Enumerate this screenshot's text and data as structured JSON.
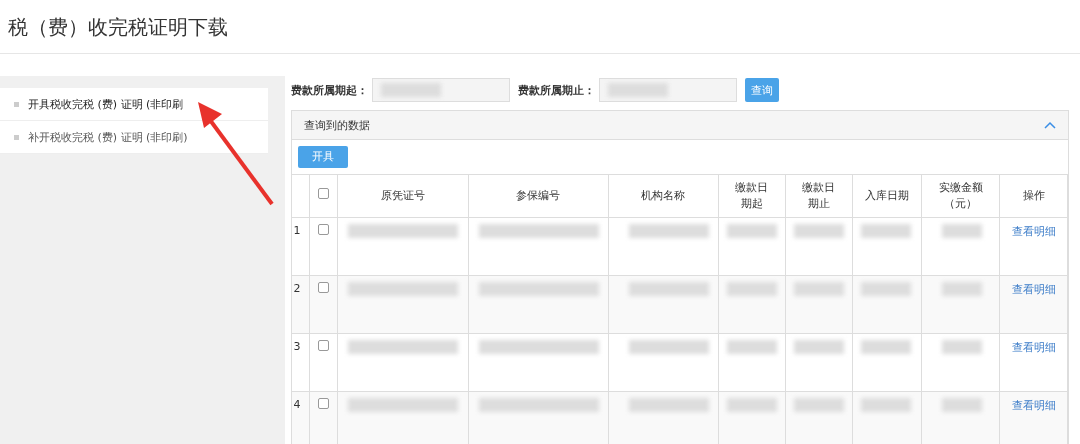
{
  "page_title": "税（费）收完税证明下载",
  "sidebar": {
    "items": [
      {
        "label": "开具税收完税 (费) 证明 (非印刷",
        "selected": true
      },
      {
        "label": "补开税收完税 (费) 证明 (非印刷)",
        "selected": false
      }
    ]
  },
  "filters": [
    {
      "label": "费款所属期起："
    },
    {
      "label": "费款所属期止："
    }
  ],
  "query_button": "查询",
  "panel": {
    "title": "查询到的数据",
    "expanded": true,
    "action_button": "开具"
  },
  "table": {
    "select_all_checked": false,
    "columns": [
      "原凭证号",
      "参保编号",
      "机构名称",
      "缴款日期起",
      "缴款日期止",
      "入库日期",
      "实缴金额（元）",
      "操作"
    ],
    "rows": [
      {
        "index": "1",
        "checked": false,
        "action": "查看明细"
      },
      {
        "index": "2",
        "checked": false,
        "action": "查看明细"
      },
      {
        "index": "3",
        "checked": false,
        "action": "查看明细"
      },
      {
        "index": "4",
        "checked": false,
        "action": "查看明细"
      }
    ]
  }
}
